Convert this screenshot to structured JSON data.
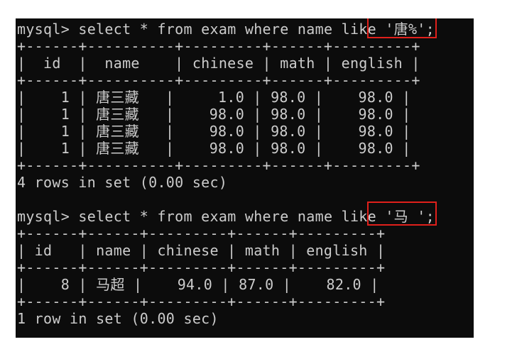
{
  "query1": {
    "prompt": "mysql> ",
    "sql": "select * from exam where name like '唐%';",
    "border": "+------+----------+---------+------+---------+",
    "header": "|  id  |  name    | chinese | math | english |",
    "rows": [
      "|    1 | 唐三藏   |     1.0 | 98.0 |    98.0 |",
      "|    1 | 唐三藏   |    98.0 | 98.0 |    98.0 |",
      "|    1 | 唐三藏   |    98.0 | 98.0 |    98.0 |",
      "|    1 | 唐三藏   |    98.0 | 98.0 |    98.0 |"
    ],
    "summary": "4 rows in set (0.00 sec)"
  },
  "query2": {
    "prompt": "mysql> ",
    "sql": "select * from exam where name like '马_';",
    "border": "+------+------+---------+------+---------+",
    "header": "| id   | name | chinese | math | english |",
    "rows": [
      "|    8 | 马超 |    94.0 | 87.0 |    82.0 |"
    ],
    "summary": "1 row in set (0.00 sec)"
  },
  "colors": {
    "terminal_bg": "#0c0c0c",
    "text": "#cccccc",
    "highlight_border": "#e0201b"
  }
}
